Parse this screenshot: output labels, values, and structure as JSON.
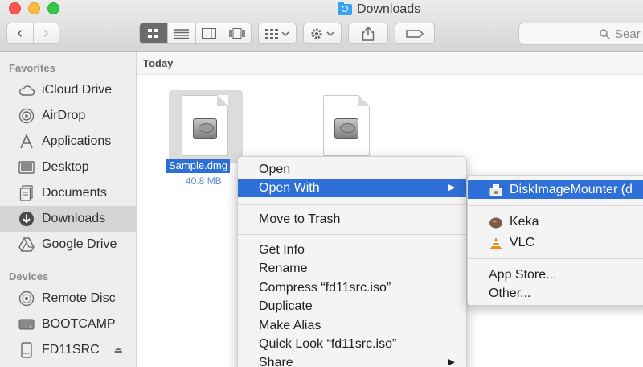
{
  "window": {
    "title": "Downloads",
    "folder_icon": "downloads-folder-icon"
  },
  "toolbar": {
    "back_glyph": "‹",
    "forward_glyph": "›",
    "search_placeholder": "Sear"
  },
  "sidebar": {
    "favorites_header": "Favorites",
    "devices_header": "Devices",
    "favorites": [
      {
        "label": "iCloud Drive",
        "icon": "cloud-icon"
      },
      {
        "label": "AirDrop",
        "icon": "airdrop-icon"
      },
      {
        "label": "Applications",
        "icon": "applications-icon"
      },
      {
        "label": "Desktop",
        "icon": "desktop-icon"
      },
      {
        "label": "Documents",
        "icon": "documents-icon"
      },
      {
        "label": "Downloads",
        "icon": "downloads-icon",
        "selected": true
      },
      {
        "label": "Google Drive",
        "icon": "google-drive-icon"
      }
    ],
    "devices": [
      {
        "label": "Remote Disc",
        "icon": "disc-icon"
      },
      {
        "label": "BOOTCAMP",
        "icon": "drive-icon"
      },
      {
        "label": "FD11SRC",
        "icon": "drive-icon",
        "eject": "⏏"
      }
    ]
  },
  "content": {
    "group_header": "Today",
    "selected_file": {
      "name": "Sample.dmg",
      "size": "40.8 MB"
    }
  },
  "context_menu": {
    "items": [
      {
        "label": "Open"
      },
      {
        "label": "Open With",
        "highlighted": true,
        "submenu_arrow": "▶"
      },
      {
        "label": "Move to Trash"
      },
      {
        "label": "Get Info"
      },
      {
        "label": "Rename"
      },
      {
        "label": "Compress “fd11src.iso”"
      },
      {
        "label": "Duplicate"
      },
      {
        "label": "Make Alias"
      },
      {
        "label": "Quick Look “fd11src.iso”"
      },
      {
        "label": "Share",
        "submenu_arrow": "▶"
      }
    ]
  },
  "open_with_menu": {
    "items": [
      {
        "label": "DiskImageMounter (d",
        "icon": "diskimagemounter-icon"
      },
      {
        "label": "Keka",
        "icon": "keka-icon"
      },
      {
        "label": "VLC",
        "icon": "vlc-icon"
      },
      {
        "label": "App Store..."
      },
      {
        "label": "Other..."
      }
    ]
  },
  "colors": {
    "selection_blue": "#2f6fd8",
    "sidebar_bg": "#eeeeee",
    "sidebar_selected": "#d4d4d4"
  }
}
